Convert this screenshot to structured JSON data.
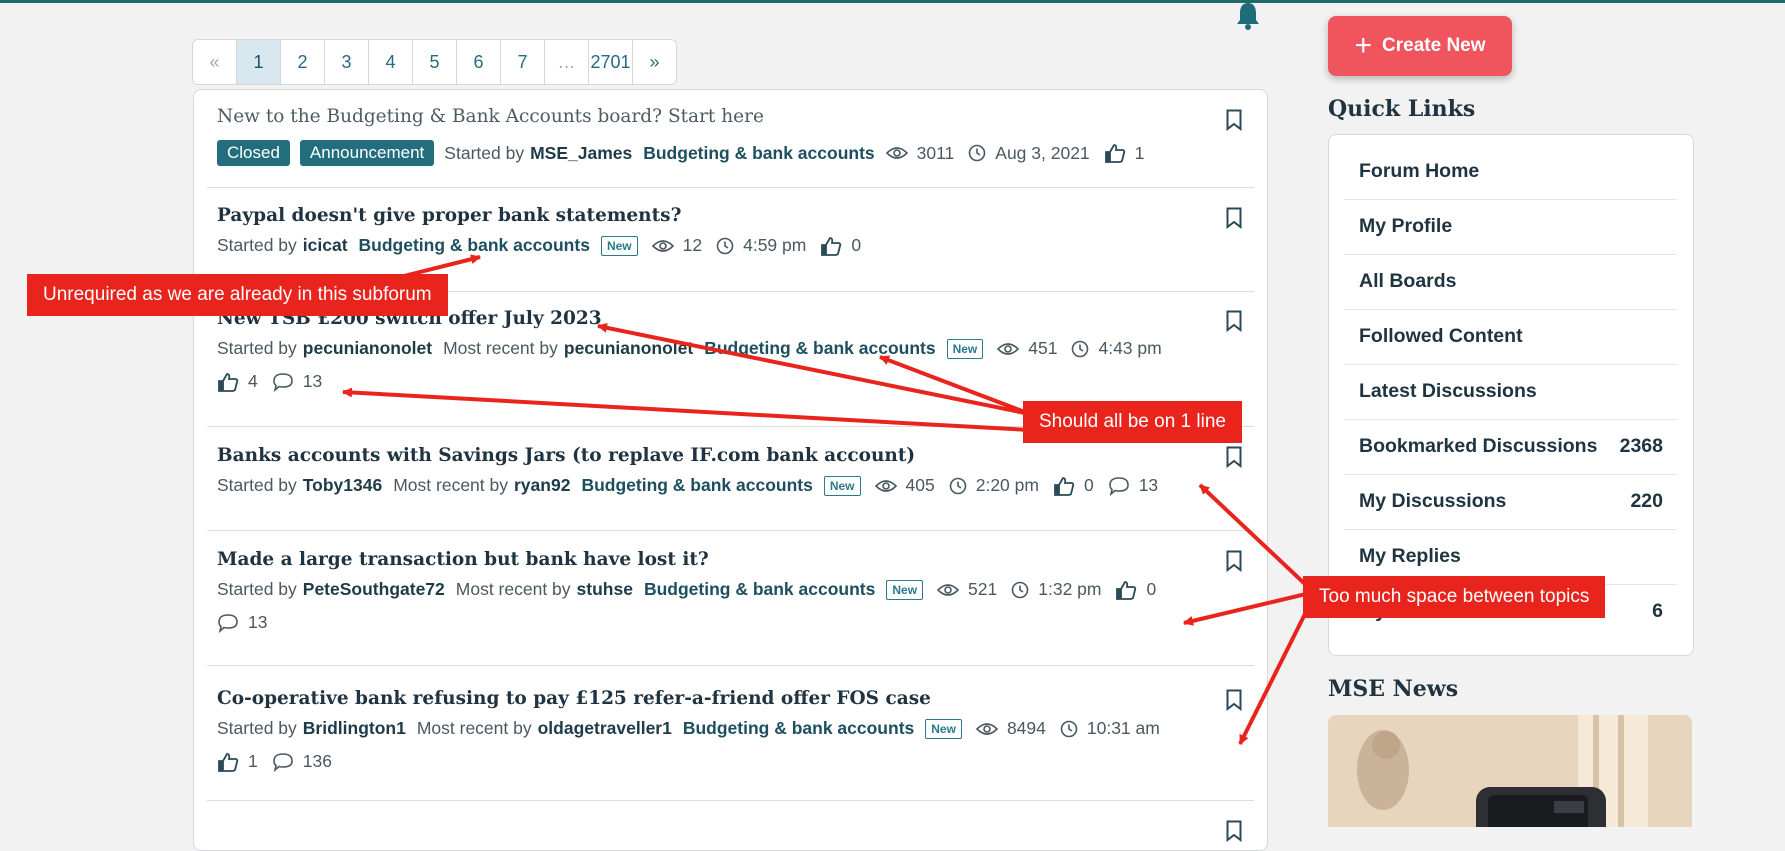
{
  "pagination": {
    "prev": "«",
    "pages": [
      "1",
      "2",
      "3",
      "4",
      "5",
      "6",
      "7",
      "…",
      "2701"
    ],
    "next": "»",
    "current": "1"
  },
  "topics": [
    {
      "title": "New to the Budgeting & Bank Accounts board? Start here",
      "tags": [
        "Closed",
        "Announcement"
      ],
      "started_label": "Started by",
      "started_by": "MSE_James",
      "board": "Budgeting & bank accounts",
      "views": "3011",
      "time": "Aug 3, 2021",
      "likes": "1"
    },
    {
      "title": "Paypal doesn't give proper bank statements?",
      "started_label": "Started by",
      "started_by": "icicat",
      "board": "Budgeting & bank accounts",
      "new_label": "New",
      "views": "12",
      "time": "4:59 pm",
      "likes": "0"
    },
    {
      "title": "New TSB £200 switch offer July 2023",
      "started_label": "Started by",
      "started_by": "pecunianonolet",
      "recent_label": "Most recent by",
      "recent_by": "pecunianonolet",
      "board": "Budgeting & bank accounts",
      "new_label": "New",
      "views": "451",
      "time": "4:43 pm",
      "likes": "4",
      "comments": "13"
    },
    {
      "title": "Banks accounts with Savings Jars (to replave IF.com bank account)",
      "started_label": "Started by",
      "started_by": "Toby1346",
      "recent_label": "Most recent by",
      "recent_by": "ryan92",
      "board": "Budgeting & bank accounts",
      "new_label": "New",
      "views": "405",
      "time": "2:20 pm",
      "likes": "0",
      "comments": "13"
    },
    {
      "title": "Made a large transaction but bank have lost it?",
      "started_label": "Started by",
      "started_by": "PeteSouthgate72",
      "recent_label": "Most recent by",
      "recent_by": "stuhse",
      "board": "Budgeting & bank accounts",
      "new_label": "New",
      "views": "521",
      "time": "1:32 pm",
      "likes": "0",
      "comments": "13"
    },
    {
      "title": "Co-operative bank refusing to pay £125 refer-a-friend offer FOS case",
      "started_label": "Started by",
      "started_by": "Bridlington1",
      "recent_label": "Most recent by",
      "recent_by": "oldagetraveller1",
      "board": "Budgeting & bank accounts",
      "new_label": "New",
      "views": "8494",
      "time": "10:31 am",
      "likes": "1",
      "comments": "136"
    }
  ],
  "sidebar": {
    "create_label": "Create New",
    "quick_links_heading": "Quick Links",
    "links": [
      {
        "label": "Forum Home",
        "count": ""
      },
      {
        "label": "My Profile",
        "count": ""
      },
      {
        "label": "All Boards",
        "count": ""
      },
      {
        "label": "Followed Content",
        "count": ""
      },
      {
        "label": "Latest Discussions",
        "count": ""
      },
      {
        "label": "Bookmarked Discussions",
        "count": "2368"
      },
      {
        "label": "My Discussions",
        "count": "220"
      },
      {
        "label": "My Replies",
        "count": ""
      },
      {
        "label": "My Drafts",
        "count": "6"
      }
    ],
    "news_heading": "MSE News"
  },
  "annotations": {
    "subforum_note": "Unrequired as we are already in this subforum",
    "one_line_note": "Should all be on 1 line",
    "space_note": "Too much space between topics"
  },
  "colors": {
    "accent": "#236e7e",
    "create_button": "#f0545c",
    "annotation_red": "#e8241c"
  }
}
